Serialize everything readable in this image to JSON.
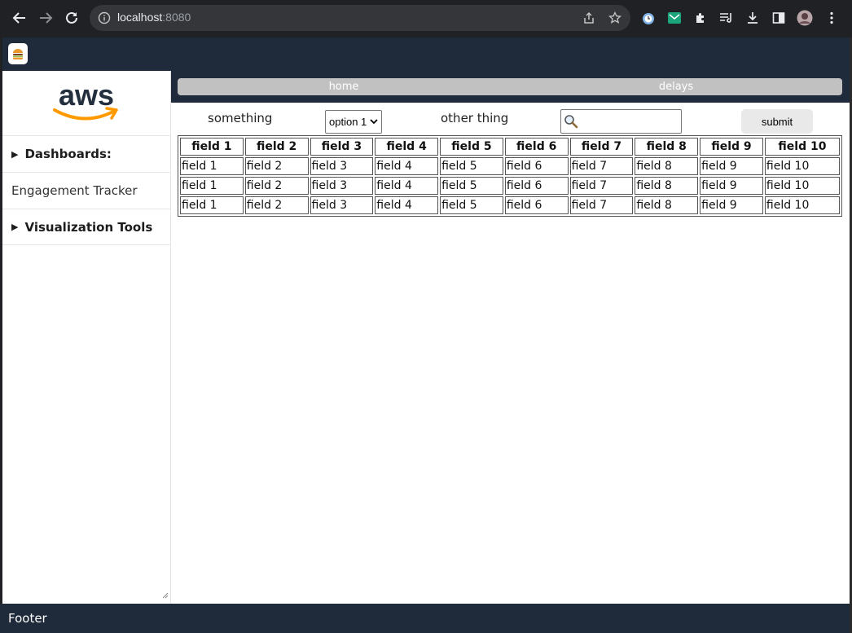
{
  "browser": {
    "url_host": "localhost",
    "url_port": ":8080",
    "icons": [
      "back-icon",
      "forward-icon",
      "reload-icon",
      "info-icon",
      "share-icon",
      "star-icon",
      "extension-alarm-icon",
      "extension-mail-icon",
      "puzzle-icon",
      "reading-list-icon",
      "download-icon",
      "side-panel-icon",
      "profile-avatar",
      "kebab-menu-icon"
    ]
  },
  "colors": {
    "header_bg": "#1f2a3a",
    "nav_bg": "#c1c1c1",
    "aws_orange": "#ff9900",
    "aws_text": "#232f3e"
  },
  "sidebar": {
    "logo_text": "aws",
    "items": [
      {
        "label": "Dashboards:",
        "expandable": true
      },
      {
        "label": "Engagement Tracker",
        "expandable": false
      },
      {
        "label": "Visualization Tools",
        "expandable": true
      }
    ]
  },
  "topnav": {
    "items": [
      "home",
      "delays"
    ]
  },
  "form": {
    "label1": "something",
    "select_value": "option 1",
    "label2": "other thing",
    "search_value": "",
    "submit_label": "submit"
  },
  "table": {
    "headers": [
      "field 1",
      "field 2",
      "field 3",
      "field 4",
      "field 5",
      "field 6",
      "field 7",
      "field 8",
      "field 9",
      "field 10"
    ],
    "rows": [
      [
        "field 1",
        "field 2",
        "field 3",
        "field 4",
        "field 5",
        "field 6",
        "field 7",
        "field 8",
        "field 9",
        "field 10"
      ],
      [
        "field 1",
        "field 2",
        "field 3",
        "field 4",
        "field 5",
        "field 6",
        "field 7",
        "field 8",
        "field 9",
        "field 10"
      ],
      [
        "field 1",
        "field 2",
        "field 3",
        "field 4",
        "field 5",
        "field 6",
        "field 7",
        "field 8",
        "field 9",
        "field 10"
      ]
    ]
  },
  "footer": {
    "text": "Footer"
  }
}
